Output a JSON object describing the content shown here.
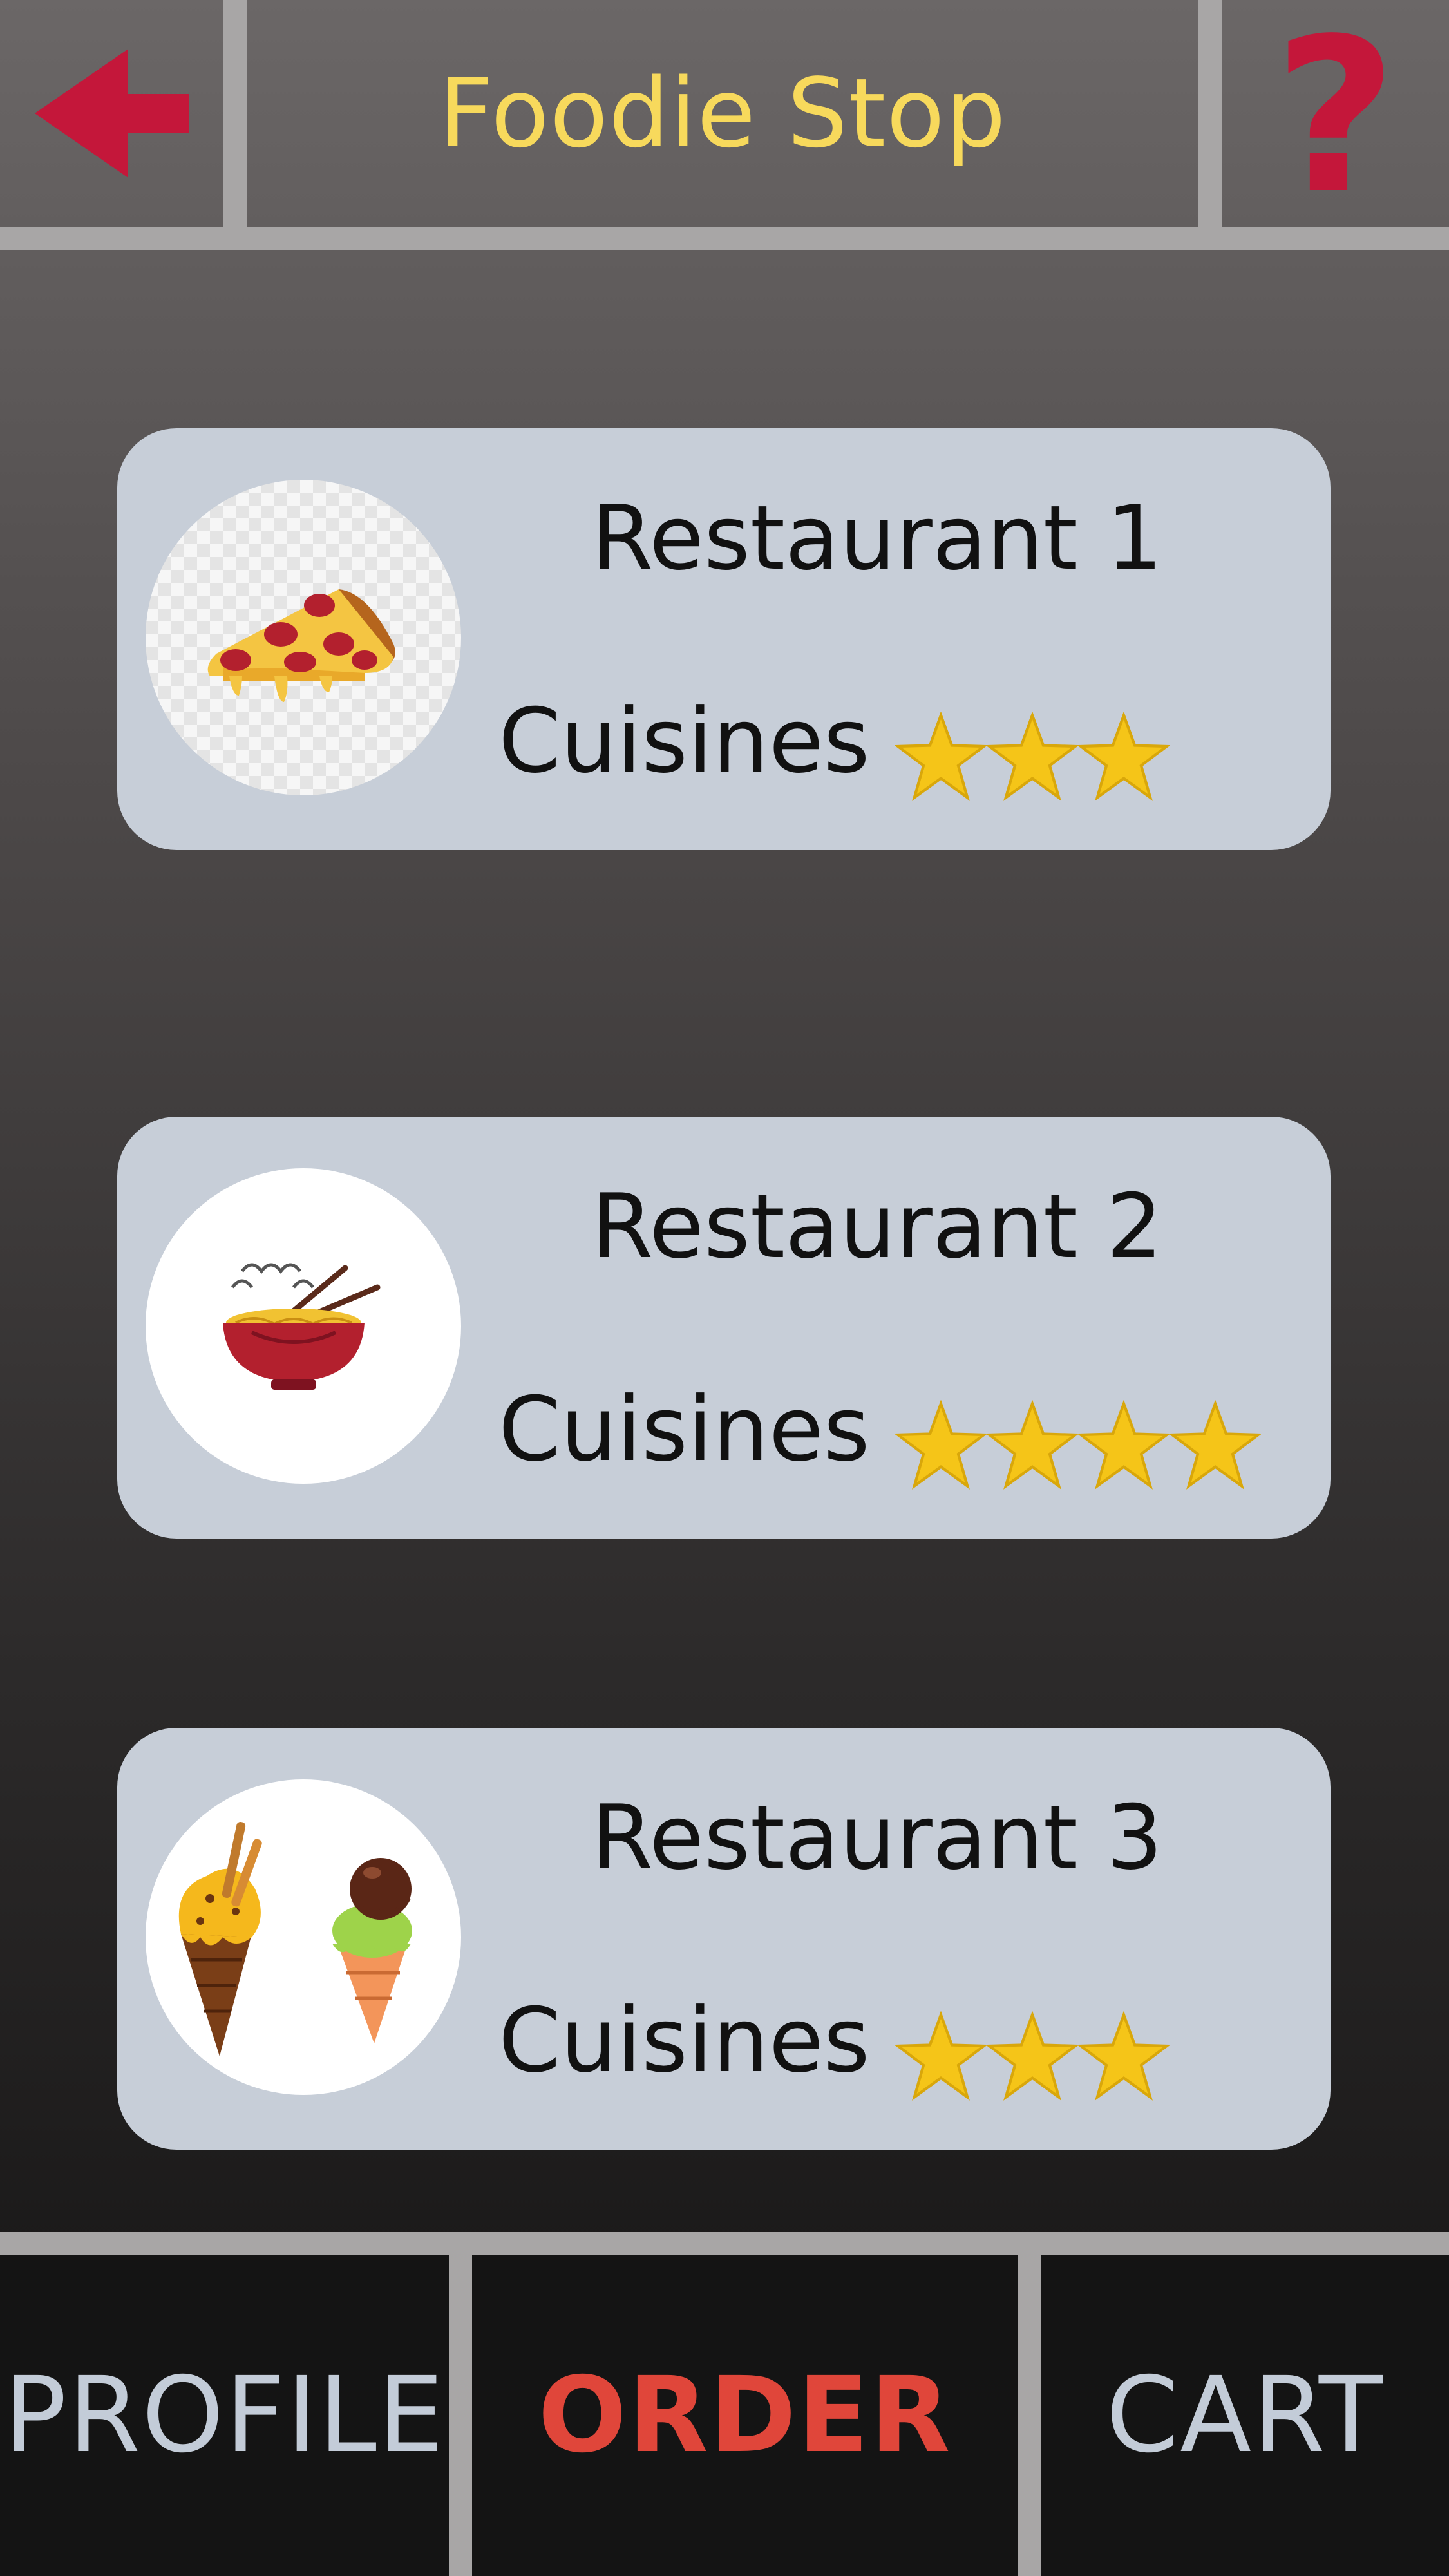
{
  "header": {
    "title": "Foodie Stop",
    "back_icon": "back-arrow-icon",
    "help_icon": "help-icon",
    "help_glyph": "?"
  },
  "restaurants": [
    {
      "name": "Restaurant 1",
      "cuisine_label": "Cuisines",
      "rating": 3,
      "image_icon": "pizza-icon"
    },
    {
      "name": "Restaurant 2",
      "cuisine_label": "Cuisines",
      "rating": 4,
      "image_icon": "noodle-bowl-icon"
    },
    {
      "name": "Restaurant 3",
      "cuisine_label": "Cuisines",
      "rating": 3,
      "image_icon": "ice-cream-icon"
    }
  ],
  "nav": {
    "items": [
      {
        "label": "PROFILE",
        "active": false
      },
      {
        "label": "ORDER",
        "active": true
      },
      {
        "label": "CART",
        "active": false
      }
    ]
  },
  "colors": {
    "title": "#f7d95c",
    "accent_red": "#c4173a",
    "active_nav": "#e0463a",
    "card_bg": "#c7ced8",
    "star": "#f5c518"
  }
}
